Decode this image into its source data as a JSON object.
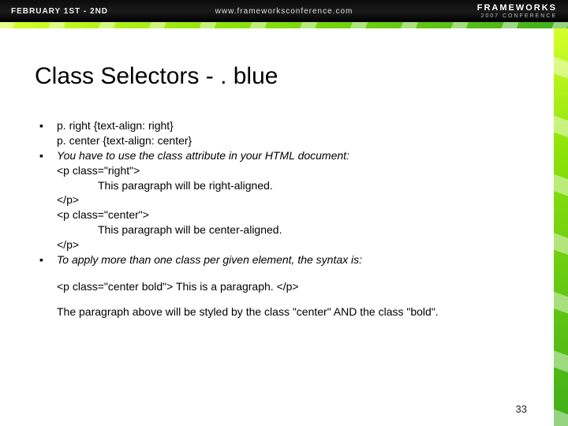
{
  "topbar": {
    "dates": "FEBRUARY 1ST - 2ND",
    "url": "www.frameworksconference.com",
    "brand_line1": "FRAMEWORKS",
    "brand_line2": "2007 CONFERENCE"
  },
  "slide": {
    "title": "Class Selectors   -   . blue",
    "bullet1_line1": "p. right {text-align: right}",
    "bullet1_line2": "p. center {text-align: center}",
    "bullet2_intro": "You have to use the class attribute in your HTML document:",
    "code_open1": "<p class=\"right\">",
    "code_body1": "This paragraph will be right-aligned.",
    "code_close1": "</p>",
    "code_open2": "<p class=\"center\">",
    "code_body2": "This paragraph will be center-aligned.",
    "code_close2": "</p>",
    "bullet3": "To apply more than one class per given element, the syntax is:",
    "after1": "<p class=\"center bold\"> This is a paragraph. </p>",
    "after2": "The paragraph above will be styled by the class \"center\" AND the class \"bold\".",
    "page_number": "33"
  }
}
